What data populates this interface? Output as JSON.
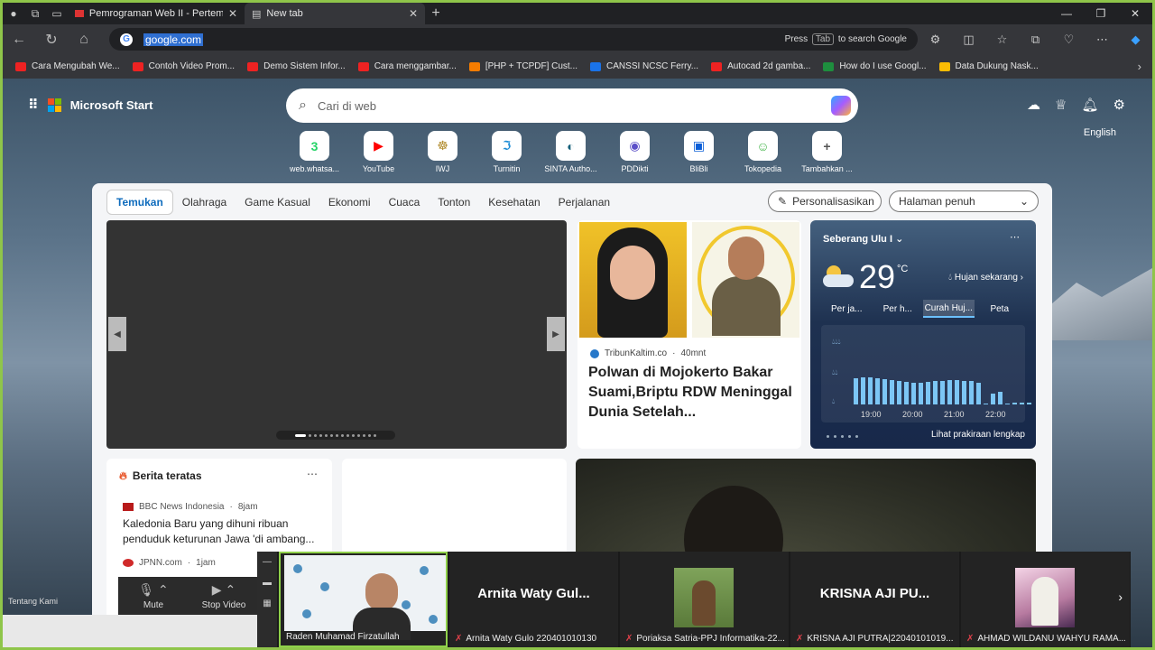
{
  "tabs": [
    {
      "title": "Pemrograman Web II - Pertemuan",
      "active": false
    },
    {
      "title": "New tab",
      "active": true
    }
  ],
  "address": {
    "url": "google.com",
    "hint_press": "Press",
    "hint_key": "Tab",
    "hint_rest": "to search Google"
  },
  "bookmarks": [
    {
      "label": "Cara Mengubah We...",
      "icon_color": "#e22"
    },
    {
      "label": "Contoh Video Prom...",
      "icon_color": "#e22"
    },
    {
      "label": "Demo Sistem Infor...",
      "icon_color": "#e22"
    },
    {
      "label": "Cara menggambar...",
      "icon_color": "#e22"
    },
    {
      "label": "[PHP + TCPDF] Cust...",
      "icon_color": "#f57c00"
    },
    {
      "label": "CANSSI NCSC Ferry...",
      "icon_color": "#1a73e8"
    },
    {
      "label": "Autocad 2d gamba...",
      "icon_color": "#e22"
    },
    {
      "label": "How do I use Googl...",
      "icon_color": "#1e8e3e"
    },
    {
      "label": "Data Dukung Nask...",
      "icon_color": "#fbbc04"
    }
  ],
  "msstart": {
    "brand": "Microsoft Start",
    "search_placeholder": "Cari di web",
    "language": "English"
  },
  "quicklinks": [
    {
      "label": "web.whatsa...",
      "glyph": "3",
      "color": "#25d366"
    },
    {
      "label": "YouTube",
      "glyph": "▶",
      "color": "#ff0000"
    },
    {
      "label": "IWJ",
      "glyph": "☸",
      "color": "#b08a2a"
    },
    {
      "label": "Turnitin",
      "glyph": "ℑ",
      "color": "#1f8dd6"
    },
    {
      "label": "SINTA Autho...",
      "glyph": "◐",
      "color": "#16607a"
    },
    {
      "label": "PDDikti",
      "glyph": "◉",
      "color": "#5b4fc8"
    },
    {
      "label": "BliBli",
      "glyph": "▣",
      "color": "#0a5ed7"
    },
    {
      "label": "Tokopedia",
      "glyph": "☺",
      "color": "#42b549"
    },
    {
      "label": "Tambahkan ...",
      "glyph": "+",
      "color": "#555"
    }
  ],
  "categories": [
    "Temukan",
    "Olahraga",
    "Game Kasual",
    "Ekonomi",
    "Cuaca",
    "Tonton",
    "Kesehatan",
    "Perjalanan"
  ],
  "personalize": "Personalisasikan",
  "page_mode": "Halaman penuh",
  "news_card": {
    "source": "TribunKaltim.co",
    "time": "40mnt",
    "title": "Polwan di Mojokerto Bakar Suami,Briptu RDW Meninggal Dunia Setelah..."
  },
  "weather": {
    "location": "Seberang Ulu I",
    "temp": "29",
    "unit": "°C",
    "now": "Hujan sekarang",
    "tabs": [
      "Per ja...",
      "Per h...",
      "Curah Huj...",
      "Peta"
    ],
    "active_tab": 2,
    "times": [
      "19:00",
      "20:00",
      "21:00",
      "22:00"
    ],
    "precip_levels": [
      0.6,
      0.62,
      0.62,
      0.6,
      0.58,
      0.56,
      0.54,
      0.52,
      0.5,
      0.5,
      0.52,
      0.54,
      0.55,
      0.56,
      0.56,
      0.55,
      0.54,
      0.5,
      0,
      0.25,
      0.3,
      0,
      0.04,
      0.04,
      0.04
    ],
    "footer": "Lihat prakiraan lengkap"
  },
  "top_news": {
    "header": "Berita teratas",
    "items": [
      {
        "source": "BBC News Indonesia",
        "time": "8jam",
        "title": "Kaledonia Baru yang dihuni ribuan penduduk keturunan Jawa 'di ambang..."
      },
      {
        "source": "JPNN.com",
        "time": "1jam",
        "title": ""
      }
    ]
  },
  "footer_link": "Tentang Kami",
  "zoom": {
    "mute": "Mute",
    "stop_video": "Stop Video",
    "participants": [
      {
        "name": "Raden Muhamad Firzatullah",
        "type": "video",
        "active": true
      },
      {
        "name": "Arnita Waty Gulo 220401010130",
        "display": "Arnita Waty Gul...",
        "type": "name"
      },
      {
        "name": "Poriaksa Satria-PPJ Informatika-22...",
        "type": "avatar"
      },
      {
        "name": "KRISNA AJI PUTRA|22040101019...",
        "display": "KRISNA AJI PU...",
        "type": "name"
      },
      {
        "name": "AHMAD WILDANU WAHYU RAMA...",
        "type": "avatar2"
      }
    ]
  }
}
